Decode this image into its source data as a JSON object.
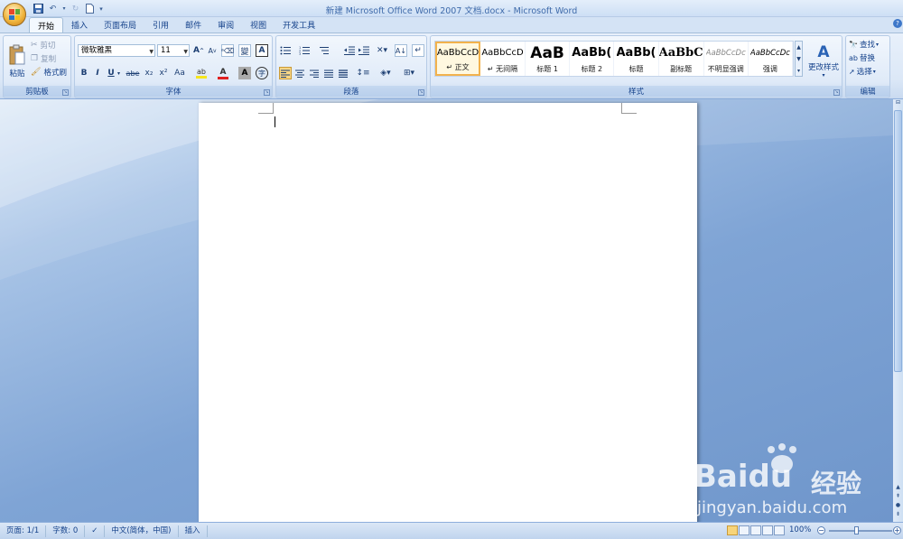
{
  "window": {
    "title": "新建 Microsoft Office Word 2007 文档.docx - Microsoft Word"
  },
  "tabs": [
    "开始",
    "插入",
    "页面布局",
    "引用",
    "邮件",
    "审阅",
    "视图",
    "开发工具"
  ],
  "clipboard": {
    "paste": "粘贴",
    "cut": "剪切",
    "copy": "复制",
    "format_painter": "格式刷",
    "label": "剪贴板"
  },
  "font": {
    "name": "微软雅黑",
    "size": "11",
    "label": "字体",
    "phonetic": "變",
    "bold": "B",
    "italic": "I",
    "underline": "U",
    "strike": "abe",
    "sub": "x₂",
    "sup": "x²",
    "case": "Aa",
    "grow": "A",
    "shrink": "A",
    "highlight_color": "#f6e51d",
    "font_color": "#e02020"
  },
  "paragraph": {
    "label": "段落"
  },
  "styles": {
    "label": "样式",
    "items": [
      {
        "sample": "AaBbCcD",
        "name": "↵ 正文",
        "selected": true
      },
      {
        "sample": "AaBbCcD",
        "name": "↵ 无间隔"
      },
      {
        "sample": "AaB",
        "name": "标题 1"
      },
      {
        "sample": "AaBb(",
        "name": "标题 2"
      },
      {
        "sample": "AaBb(",
        "name": "标题"
      },
      {
        "sample": "AaBbC",
        "name": "副标题"
      },
      {
        "sample": "AaBbCcDc",
        "name": "不明显强调"
      },
      {
        "sample": "AaBbCcDc",
        "name": "强调"
      }
    ],
    "change_styles": "更改样式"
  },
  "editing": {
    "find": "查找",
    "replace": "替换",
    "select": "选择",
    "label": "编辑"
  },
  "status": {
    "page": "页面: 1/1",
    "words": "字数: 0",
    "language": "中文(简体，中国)",
    "mode": "插入",
    "zoom": "100%"
  },
  "watermark": {
    "brand": "Baidu",
    "brand_cn": "经验",
    "url": "jingyan.baidu.com"
  }
}
